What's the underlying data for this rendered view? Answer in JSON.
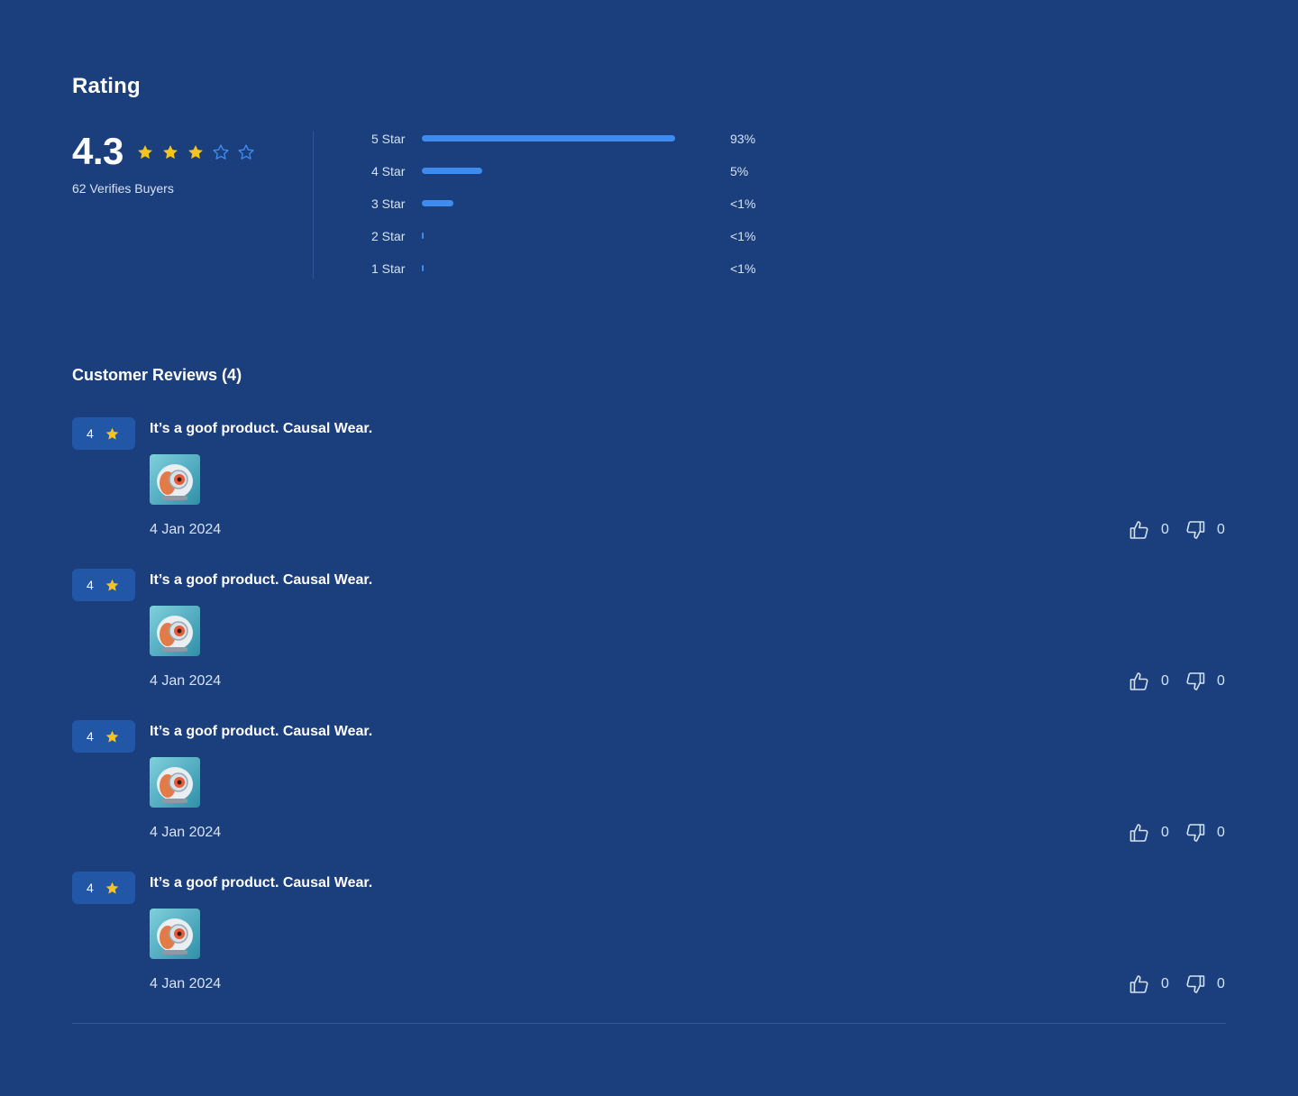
{
  "rating": {
    "title": "Rating",
    "score": "4.3",
    "stars": [
      {
        "icon": "star-filled-icon"
      },
      {
        "icon": "star-filled-icon"
      },
      {
        "icon": "star-filled-icon"
      },
      {
        "icon": "star-outline-icon"
      },
      {
        "icon": "star-outline-icon"
      }
    ],
    "buyers": "62 Verifies Buyers",
    "distribution": [
      {
        "label": "5 Star",
        "fill_fraction": 0.97,
        "percent": "93%"
      },
      {
        "label": "4 Star",
        "fill_fraction": 0.23,
        "percent": "5%"
      },
      {
        "label": "3 Star",
        "fill_fraction": 0.12,
        "percent": "<1%"
      },
      {
        "label": "2 Star",
        "fill_fraction": 0.0,
        "percent": "<1%"
      },
      {
        "label": "1 Star",
        "fill_fraction": 0.0,
        "percent": "<1%"
      }
    ]
  },
  "reviews_section": {
    "title": "Customer Reviews (4)",
    "reviews": [
      {
        "rating": "4",
        "text": "It’s a goof product. Causal Wear.",
        "image_icon": "robot-helmet-thumbnail",
        "date": "4 Jan 2024",
        "likes": "0",
        "dislikes": "0"
      },
      {
        "rating": "4",
        "text": "It’s a goof product. Causal Wear.",
        "image_icon": "robot-helmet-thumbnail",
        "date": "4 Jan 2024",
        "likes": "0",
        "dislikes": "0"
      },
      {
        "rating": "4",
        "text": "It’s a goof product. Causal Wear.",
        "image_icon": "robot-helmet-thumbnail",
        "date": "4 Jan 2024",
        "likes": "0",
        "dislikes": "0"
      },
      {
        "rating": "4",
        "text": "It’s a goof product. Causal Wear.",
        "image_icon": "robot-helmet-thumbnail",
        "date": "4 Jan 2024",
        "likes": "0",
        "dislikes": "0"
      }
    ]
  },
  "colors": {
    "background": "#1b3f7d",
    "accent_bar": "#3f8cf0",
    "star_filled": "#f5c518",
    "star_outline": "#3f8cf0",
    "badge_bg": "#2256a6"
  }
}
